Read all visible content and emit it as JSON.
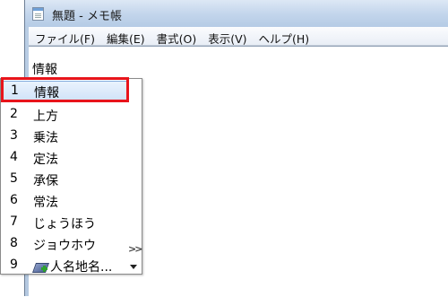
{
  "window": {
    "title": "無題 - メモ帳"
  },
  "menubar": {
    "items": [
      "ファイル(F)",
      "編集(E)",
      "書式(O)",
      "表示(V)",
      "ヘルプ(H)"
    ]
  },
  "editor": {
    "text": "情報"
  },
  "candidate_list": {
    "selected_index": 1,
    "items": [
      {
        "num": "1",
        "word": "情報"
      },
      {
        "num": "2",
        "word": "上方"
      },
      {
        "num": "3",
        "word": "乗法"
      },
      {
        "num": "4",
        "word": "定法"
      },
      {
        "num": "5",
        "word": "承保"
      },
      {
        "num": "6",
        "word": "常法"
      },
      {
        "num": "7",
        "word": "じょうほう"
      },
      {
        "num": "8",
        "word": "ジョウホウ"
      },
      {
        "num": "9",
        "word": "人名地名..."
      }
    ],
    "more_icon": "double-chevron-right",
    "scroll_icon": "triangle-down",
    "dictionary_icon": "book-plus",
    "highlight_color": "#e8141b"
  }
}
